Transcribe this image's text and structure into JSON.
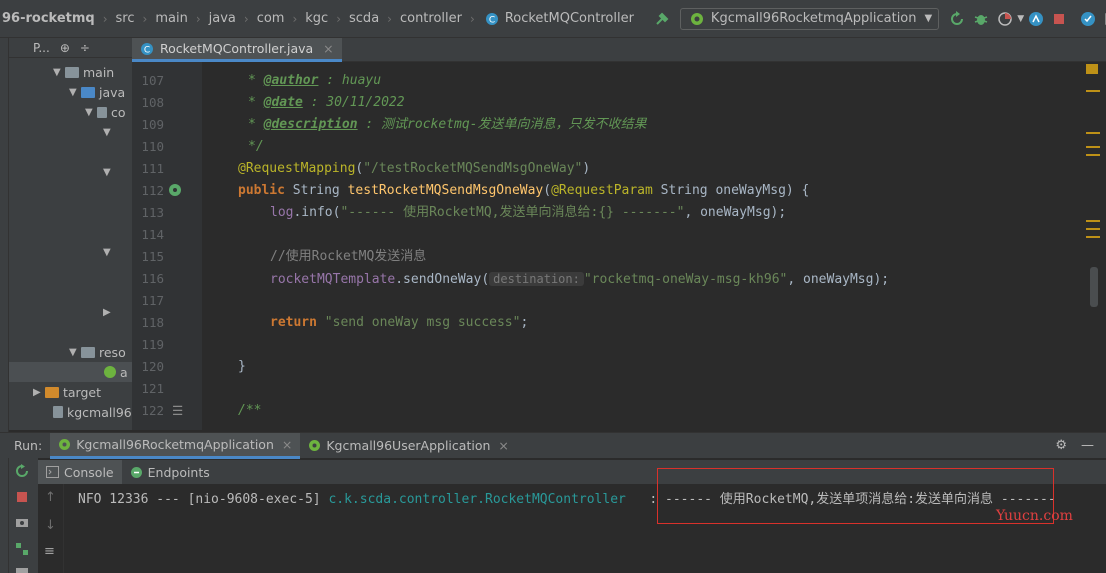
{
  "navbar": {
    "breadcrumbs": [
      "96-rocketmq",
      "src",
      "main",
      "java",
      "com",
      "kgc",
      "scda",
      "controller",
      "RocketMQController"
    ],
    "run_config": "Kgcmall96RocketmqApplication"
  },
  "project": {
    "header": "P...",
    "tree": [
      {
        "label": "main",
        "kind": "folder"
      },
      {
        "label": "java",
        "kind": "folder-blue"
      },
      {
        "label": "co",
        "kind": "package"
      },
      {
        "label": "reso",
        "kind": "folder"
      },
      {
        "label": "a",
        "kind": "file"
      },
      {
        "label": "target",
        "kind": "folder-orange"
      },
      {
        "label": "kgcmall96-",
        "kind": "file"
      }
    ]
  },
  "editor": {
    "tab_label": "RocketMQController.java",
    "line_numbers": [
      "107",
      "108",
      "109",
      "110",
      "111",
      "112",
      "113",
      "114",
      "115",
      "116",
      "117",
      "118",
      "119",
      "120",
      "121",
      "122"
    ],
    "lines": {
      "l107_tag": "@author",
      "l107_val": " : huayu",
      "l108_tag": "@date",
      "l108_val": " : 30/11/2022",
      "l109_tag": "@description",
      "l109_val": " : 测试rocketmq-发送单向消息，只发不收结果",
      "l110": "*/",
      "l111_ann": "@RequestMapping",
      "l111_arg": "\"/testRocketMQSendMsgOneWay\"",
      "l112_kw": "public",
      "l112_type": " String ",
      "l112_method": "testRocketMQSendMsgOneWay",
      "l112_param_ann": "@RequestParam",
      "l112_param": " String oneWayMsg) {",
      "l113_field": "log",
      "l113_method": ".info(",
      "l113_str": "\"------ 使用RocketMQ,发送单向消息给:{} -------\"",
      "l113_rest": ", oneWayMsg);",
      "l115_comment": "//使用RocketMQ发送消息",
      "l116_field": "rocketMQTemplate",
      "l116_method": ".sendOneWay(",
      "l116_hint": "destination:",
      "l116_str": "\"rocketmq-oneWay-msg-kh96\"",
      "l116_rest": ", oneWayMsg);",
      "l118_kw": "return",
      "l118_str": "\"send oneWay msg success\"",
      "l118_rest": ";",
      "l120": "}",
      "l122": "/**"
    }
  },
  "run_panel": {
    "label": "Run:",
    "tabs": [
      "Kgcmall96RocketmqApplication",
      "Kgcmall96UserApplication"
    ],
    "console_tabs": [
      "Console",
      "Endpoints"
    ],
    "log": {
      "prefix": "NFO 12336 --- [nio-9608-exec-5] ",
      "class": "c.k.scda.controller.RocketMQController",
      "message": "   : ------ 使用RocketMQ,发送单项消息给:发送单向消息 -------"
    }
  },
  "watermark": "Yuucn.com",
  "colors": {
    "accent": "#4a88c7",
    "highlight_box": "#d9312b"
  }
}
